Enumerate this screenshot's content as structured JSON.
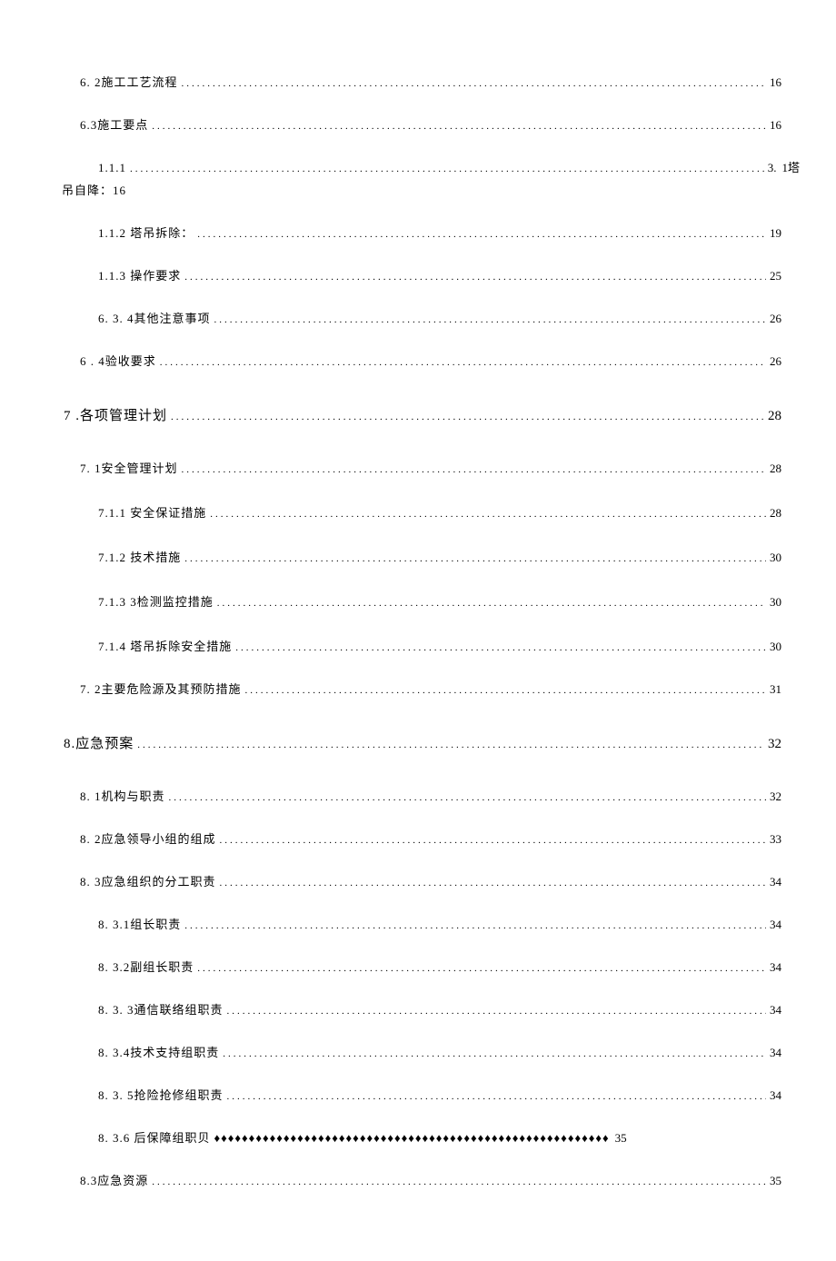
{
  "toc": {
    "r_6_2": {
      "label": "6. 2施工工艺流程",
      "page": "16"
    },
    "r_6_3": {
      "label": "6.3施工要点",
      "page": "16"
    },
    "r_1_1_1": {
      "label": "1.1.1",
      "page": "3.",
      "trail1": "1塔",
      "trail2": "吊自降：16"
    },
    "r_1_1_2": {
      "label": "1.1.2  塔吊拆除：",
      "page": "19"
    },
    "r_1_1_3": {
      "label": "1.1.3  操作要求",
      "page": "25"
    },
    "r_6_3_4": {
      "label": "6. 3. 4其他注意事项",
      "page": "26"
    },
    "r_6_4": {
      "label": "6 . 4验收要求",
      "page": "26"
    },
    "r_7": {
      "label": "7 .各项管理计划",
      "page": "28"
    },
    "r_7_1": {
      "label": "7. 1安全管理计划",
      "page": "28"
    },
    "r_7_1_1": {
      "label": "7.1.1  安全保证措施",
      "page": "28"
    },
    "r_7_1_2": {
      "label": "7.1.2  技术措施",
      "page": "30"
    },
    "r_7_1_3": {
      "label": "7.1.3 3检测监控措施",
      "page": "30"
    },
    "r_7_1_4": {
      "label": "7.1.4  塔吊拆除安全措施",
      "page": "30"
    },
    "r_7_2": {
      "label": "7. 2主要危险源及其预防措施",
      "page": "31"
    },
    "r_8": {
      "label": "8.应急预案",
      "page": "32"
    },
    "r_8_1": {
      "label": "8. 1机构与职责",
      "page": "32"
    },
    "r_8_2": {
      "label": "8. 2应急领导小组的组成",
      "page": "33"
    },
    "r_8_3": {
      "label": "8. 3应急组织的分工职责",
      "page": "34"
    },
    "r_8_3_1": {
      "label": "8. 3.1组长职责",
      "page": "34"
    },
    "r_8_3_2": {
      "label": "8. 3.2副组长职责",
      "page": "34"
    },
    "r_8_3_3": {
      "label": "8. 3. 3通信联络组职责",
      "page": "34"
    },
    "r_8_3_4": {
      "label": "8. 3.4技术支持组职责",
      "page": "34"
    },
    "r_8_3_5": {
      "label": "8. 3. 5抢险抢修组职责",
      "page": "34"
    },
    "r_8_3_6": {
      "label": "8. 3.6 后保障组职贝",
      "diamonds": "♦♦♦♦♦♦♦♦♦♦♦♦♦♦♦♦♦♦♦♦♦♦♦♦♦♦♦♦♦♦♦♦♦♦♦♦♦♦♦♦♦♦♦♦♦♦♦♦♦♦♦♦♦♦♦♦♦",
      "page": "35"
    },
    "r_8_3b": {
      "label": "8.3应急资源",
      "page": "35"
    }
  }
}
